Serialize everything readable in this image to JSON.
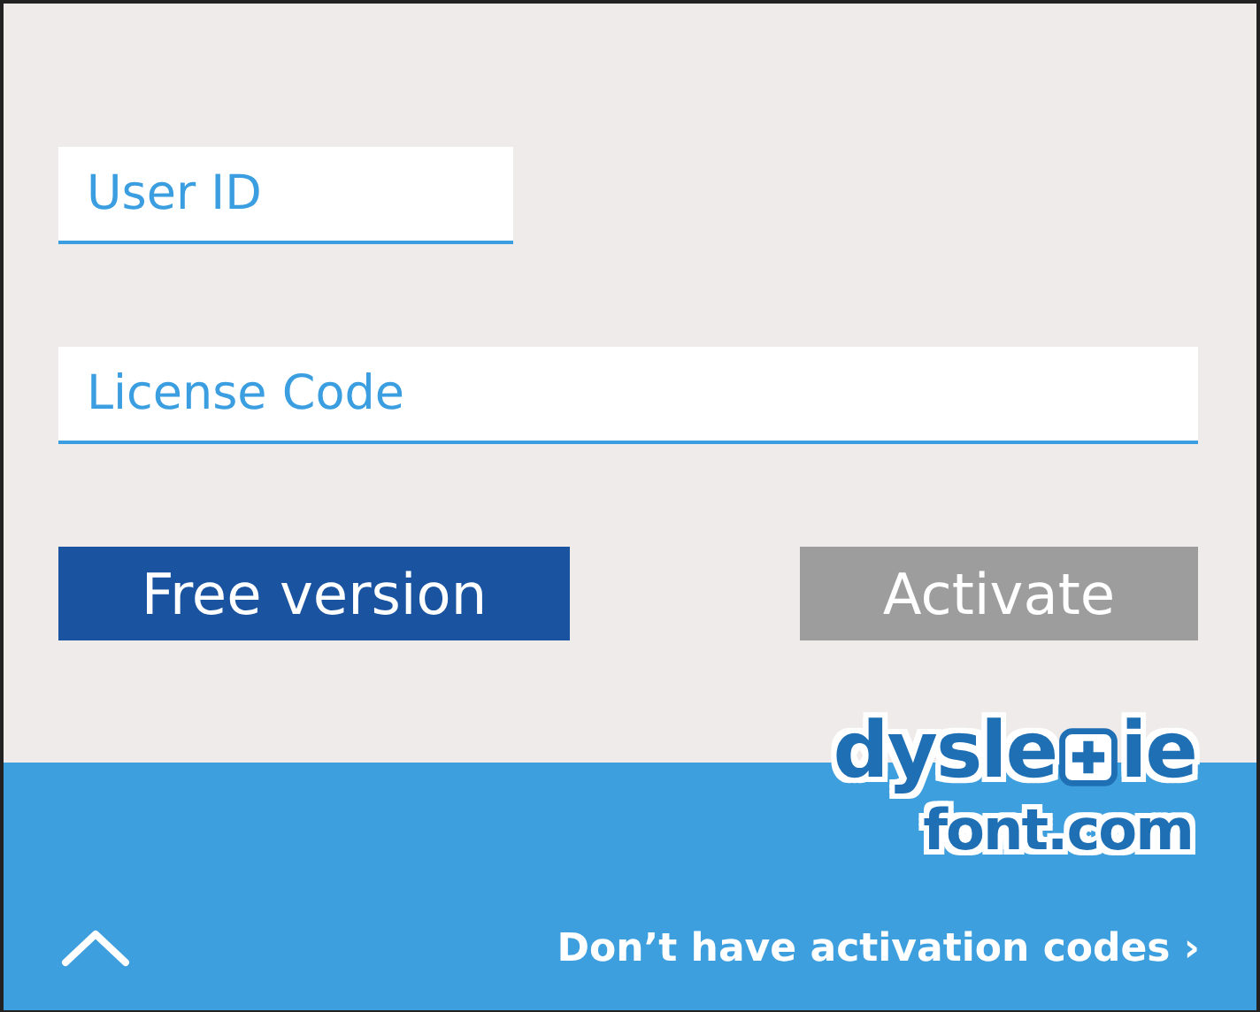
{
  "fields": [
    {
      "placeholder": "User ID",
      "kind": "short"
    },
    {
      "placeholder": "License Code",
      "kind": "full"
    }
  ],
  "buttons": [
    {
      "label": "Free version",
      "kind": "primary",
      "disabled": false
    },
    {
      "label": "Activate",
      "kind": "secondary",
      "disabled": true
    }
  ],
  "logo": {
    "before": "dysle",
    "after": "ie",
    "domain": "font.com"
  },
  "footer": {
    "link": "Don’t have activation codes ›"
  }
}
